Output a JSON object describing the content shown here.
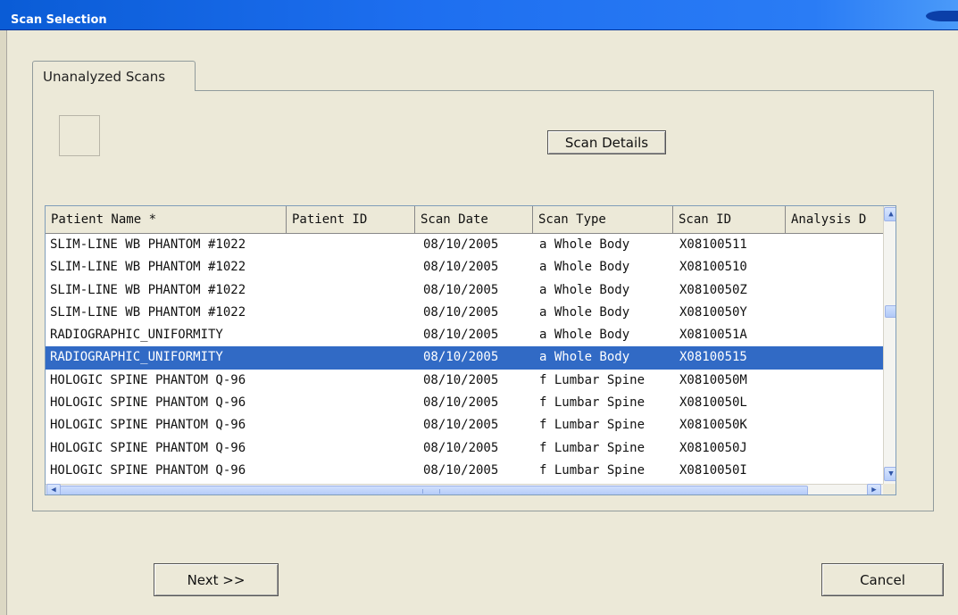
{
  "window": {
    "title": "Scan Selection"
  },
  "tabs": [
    {
      "label": "Unanalyzed Scans"
    }
  ],
  "buttons": {
    "scan_details": "Scan Details",
    "next": "Next >>",
    "cancel": "Cancel"
  },
  "table": {
    "columns": [
      "Patient Name *",
      "Patient ID",
      "Scan Date",
      "Scan Type",
      "Scan ID",
      "Analysis D"
    ],
    "rows": [
      [
        "SLIM-LINE WB PHANTOM #1022",
        "",
        "08/10/2005",
        "a Whole Body",
        "X08100511",
        ""
      ],
      [
        "SLIM-LINE WB PHANTOM #1022",
        "",
        "08/10/2005",
        "a Whole Body",
        "X08100510",
        ""
      ],
      [
        "SLIM-LINE WB PHANTOM #1022",
        "",
        "08/10/2005",
        "a Whole Body",
        "X0810050Z",
        ""
      ],
      [
        "SLIM-LINE WB PHANTOM #1022",
        "",
        "08/10/2005",
        "a Whole Body",
        "X0810050Y",
        ""
      ],
      [
        "RADIOGRAPHIC_UNIFORMITY",
        "",
        "08/10/2005",
        "a Whole Body",
        "X0810051A",
        ""
      ],
      [
        "RADIOGRAPHIC_UNIFORMITY",
        "",
        "08/10/2005",
        "a Whole Body",
        "X08100515",
        ""
      ],
      [
        "HOLOGIC SPINE PHANTOM Q-96",
        "",
        "08/10/2005",
        "f Lumbar Spine",
        "X0810050M",
        ""
      ],
      [
        "HOLOGIC SPINE PHANTOM Q-96",
        "",
        "08/10/2005",
        "f Lumbar Spine",
        "X0810050L",
        ""
      ],
      [
        "HOLOGIC SPINE PHANTOM Q-96",
        "",
        "08/10/2005",
        "f Lumbar Spine",
        "X0810050K",
        ""
      ],
      [
        "HOLOGIC SPINE PHANTOM Q-96",
        "",
        "08/10/2005",
        "f Lumbar Spine",
        "X0810050J",
        ""
      ],
      [
        "HOLOGIC SPINE PHANTOM Q-96",
        "",
        "08/10/2005",
        "f Lumbar Spine",
        "X0810050I",
        ""
      ]
    ],
    "selected_row": 5
  },
  "icons": {
    "scroll_up": "chevron-up-icon",
    "scroll_down": "chevron-down-icon",
    "scroll_left": "chevron-left-icon",
    "scroll_right": "chevron-right-icon"
  },
  "colors": {
    "title_bar": "#0a5cd6",
    "selection": "#316ac5",
    "face": "#ece9d8"
  }
}
